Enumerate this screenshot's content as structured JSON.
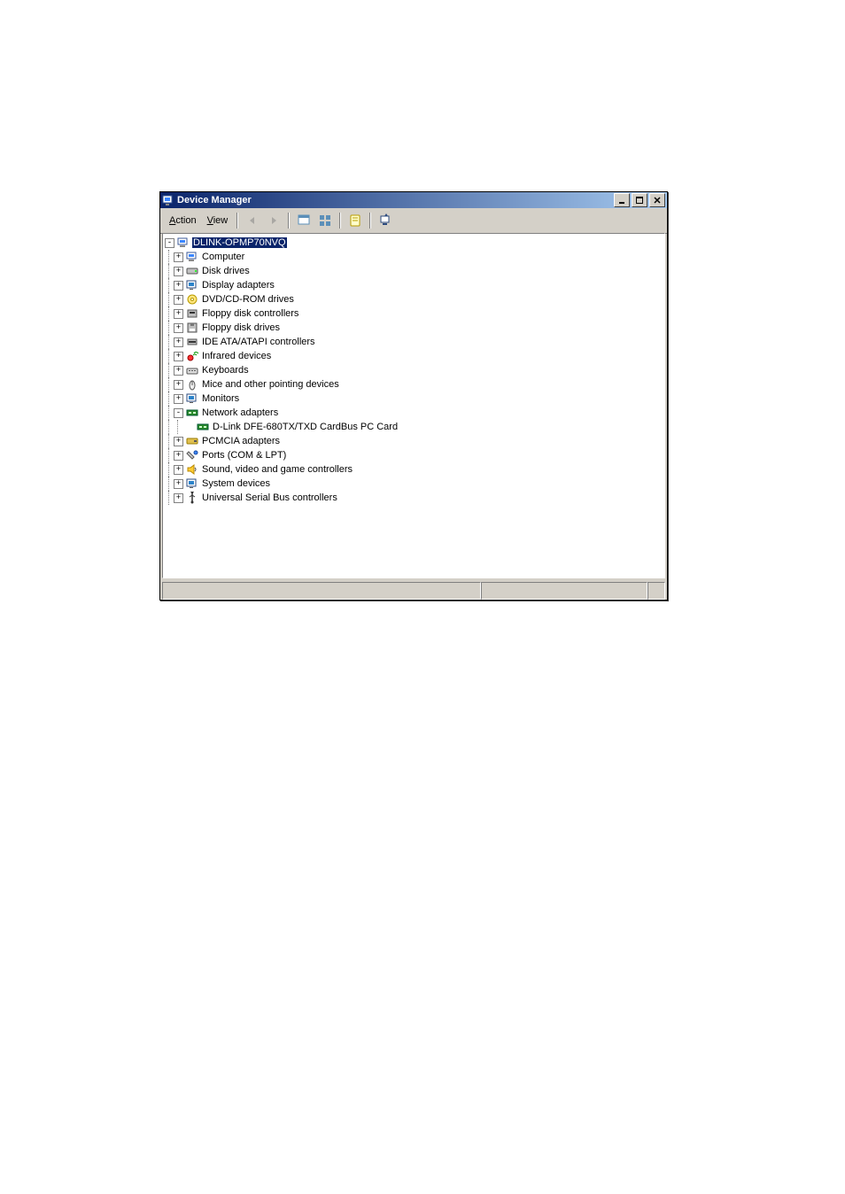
{
  "window": {
    "title": "Device Manager"
  },
  "menu": {
    "action": "Action",
    "view": "View"
  },
  "tree": {
    "root": "DLINK-OPMP70NVQ",
    "items": [
      {
        "label": "Computer",
        "icon": "computer"
      },
      {
        "label": "Disk drives",
        "icon": "disk"
      },
      {
        "label": "Display adapters",
        "icon": "display"
      },
      {
        "label": "DVD/CD-ROM drives",
        "icon": "dvd"
      },
      {
        "label": "Floppy disk controllers",
        "icon": "floppyctl"
      },
      {
        "label": "Floppy disk drives",
        "icon": "floppy"
      },
      {
        "label": "IDE ATA/ATAPI controllers",
        "icon": "ide"
      },
      {
        "label": "Infrared devices",
        "icon": "infrared"
      },
      {
        "label": "Keyboards",
        "icon": "keyboard"
      },
      {
        "label": "Mice and other pointing devices",
        "icon": "mouse"
      },
      {
        "label": "Monitors",
        "icon": "monitor"
      },
      {
        "label": "Network adapters",
        "icon": "network",
        "expanded": true,
        "children": [
          {
            "label": "D-Link DFE-680TX/TXD CardBus PC Card",
            "icon": "netcard"
          }
        ]
      },
      {
        "label": "PCMCIA adapters",
        "icon": "pcmcia"
      },
      {
        "label": "Ports (COM & LPT)",
        "icon": "ports"
      },
      {
        "label": "Sound, video and game controllers",
        "icon": "sound"
      },
      {
        "label": "System devices",
        "icon": "system"
      },
      {
        "label": "Universal Serial Bus controllers",
        "icon": "usb"
      }
    ]
  }
}
